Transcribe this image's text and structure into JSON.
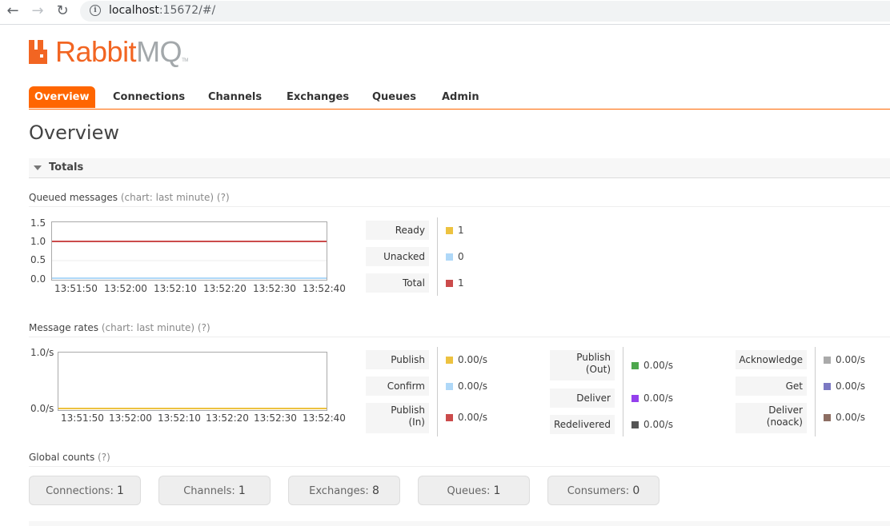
{
  "browser": {
    "url_host": "localhost",
    "url_rest": ":15672/#/"
  },
  "logo": {
    "part1": "Rabbit",
    "part2": "MQ",
    "tm": "TM"
  },
  "tabs": [
    "Overview",
    "Connections",
    "Channels",
    "Exchanges",
    "Queues",
    "Admin"
  ],
  "page_title": "Overview",
  "totals_label": "Totals",
  "queued": {
    "heading": "Queued messages",
    "hint": "(chart: last minute) (?)",
    "y_ticks": [
      "1.5",
      "1.0",
      "0.5",
      "0.0"
    ],
    "x_ticks": [
      "13:51:50",
      "13:52:00",
      "13:52:10",
      "13:52:20",
      "13:52:30",
      "13:52:40"
    ],
    "legend": [
      {
        "label": "Ready",
        "value": "1",
        "color": "#edc240"
      },
      {
        "label": "Unacked",
        "value": "0",
        "color": "#afd8f8"
      },
      {
        "label": "Total",
        "value": "1",
        "color": "#cb4b4b"
      }
    ]
  },
  "rates": {
    "heading": "Message rates",
    "hint": "(chart: last minute) (?)",
    "y_ticks": [
      "1.0/s",
      "0.0/s"
    ],
    "x_ticks": [
      "13:51:50",
      "13:52:00",
      "13:52:10",
      "13:52:20",
      "13:52:30",
      "13:52:40"
    ],
    "col1": [
      {
        "label": "Publish",
        "value": "0.00/s",
        "color": "#edc240"
      },
      {
        "label": "Confirm",
        "value": "0.00/s",
        "color": "#afd8f8"
      },
      {
        "label": "Publish\n(In)",
        "value": "0.00/s",
        "color": "#cb4b4b"
      }
    ],
    "col2": [
      {
        "label": "Publish\n(Out)",
        "value": "0.00/s",
        "color": "#4da74d"
      },
      {
        "label": "Deliver",
        "value": "0.00/s",
        "color": "#9440ed"
      },
      {
        "label": "Redelivered",
        "value": "0.00/s",
        "color": "#555555"
      }
    ],
    "col3": [
      {
        "label": "Acknowledge",
        "value": "0.00/s",
        "color": "#aaaaaa"
      },
      {
        "label": "Get",
        "value": "0.00/s",
        "color": "#7c79c3"
      },
      {
        "label": "Deliver\n(noack)",
        "value": "0.00/s",
        "color": "#8d6e63"
      }
    ]
  },
  "global": {
    "heading": "Global counts",
    "hint": "(?)",
    "items": [
      {
        "label": "Connections:",
        "value": "1"
      },
      {
        "label": "Channels:",
        "value": "1"
      },
      {
        "label": "Exchanges:",
        "value": "8"
      },
      {
        "label": "Queues:",
        "value": "1"
      },
      {
        "label": "Consumers:",
        "value": "0"
      }
    ]
  }
}
